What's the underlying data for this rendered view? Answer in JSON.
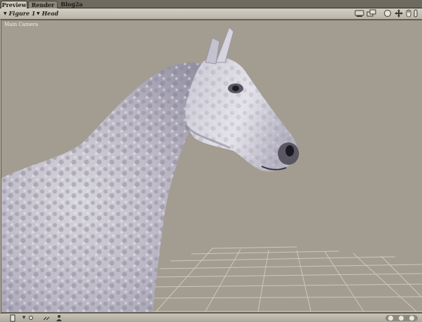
{
  "tabs": [
    {
      "label": "Preview",
      "active": true
    },
    {
      "label": "Render",
      "active": false
    },
    {
      "label": "Blog2a",
      "active": false
    }
  ],
  "header": {
    "figure_selector": "Figure 1",
    "part_selector": "Head",
    "icons": [
      "monitor-icon",
      "windows-icon",
      "render-circle-icon",
      "move-cross-icon",
      "pan-hand-icon",
      "zoom-bar-icon"
    ]
  },
  "viewport": {
    "camera_label": "Main Camera",
    "background_color": "#a39c91",
    "subject": "horse-figure"
  },
  "bottombar": {
    "icons": [
      "document-icon",
      "dropdown-arrow-icon",
      "light-icon",
      "link-icon",
      "figure-icon"
    ],
    "view_buttons": [
      "view-dot-1",
      "view-dot-2",
      "view-dot-3"
    ]
  },
  "colors": {
    "tab_active": "#cfcabd",
    "tab_inactive": "#8d887b",
    "header": "#c4bfb3",
    "grid_line": "#d8d2c6"
  }
}
